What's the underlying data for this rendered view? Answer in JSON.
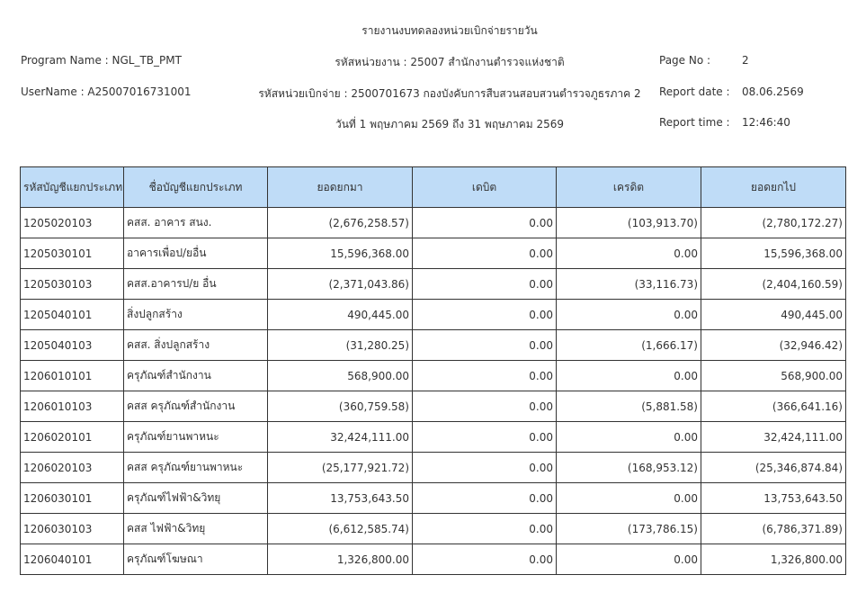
{
  "report": {
    "title": "รายงานงบทดลองหน่วยเบิกจ่ายรายวัน",
    "program_name": "Program Name : NGL_TB_PMT",
    "user_name": "UserName : A25007016731001",
    "agency": "รหัสหน่วยงาน : 25007 สำนักงานตำรวจแห่งชาติ",
    "disbursement_unit": "รหัสหน่วยเบิกจ่าย : 2500701673 กองบังคับการสืบสวนสอบสวนตำรวจภูธรภาค 2",
    "period": "วันที่ 1 พฤษภาคม 2569 ถึง 31 พฤษภาคม 2569",
    "page_no_label": "Page No :",
    "page_no_value": "2",
    "report_date_label": "Report date :",
    "report_date_value": "08.06.2569",
    "report_time_label": "Report time :",
    "report_time_value": "12:46:40"
  },
  "table": {
    "columns": [
      "รหัสบัญชีแยกประเภท",
      "ชื่อบัญชีแยกประเภท",
      "ยอดยกมา",
      "เดบิต",
      "เครดิต",
      "ยอดยกไป"
    ],
    "rows": [
      [
        "1205020103",
        "คสส. อาคาร สนง.",
        "(2,676,258.57)",
        "0.00",
        "(103,913.70)",
        "(2,780,172.27)"
      ],
      [
        "1205030101",
        "อาคารเพื่อป/ยอื่น",
        "15,596,368.00",
        "0.00",
        "0.00",
        "15,596,368.00"
      ],
      [
        "1205030103",
        "คสส.อาคารป/ย อื่น",
        "(2,371,043.86)",
        "0.00",
        "(33,116.73)",
        "(2,404,160.59)"
      ],
      [
        "1205040101",
        "สิ่งปลูกสร้าง",
        "490,445.00",
        "0.00",
        "0.00",
        "490,445.00"
      ],
      [
        "1205040103",
        "คสส. สิ่งปลูกสร้าง",
        "(31,280.25)",
        "0.00",
        "(1,666.17)",
        "(32,946.42)"
      ],
      [
        "1206010101",
        "ครุภัณฑ์สำนักงาน",
        "568,900.00",
        "0.00",
        "0.00",
        "568,900.00"
      ],
      [
        "1206010103",
        "คสส ครุภัณฑ์สำนักงาน",
        "(360,759.58)",
        "0.00",
        "(5,881.58)",
        "(366,641.16)"
      ],
      [
        "1206020101",
        "ครุภัณฑ์ยานพาหนะ",
        "32,424,111.00",
        "0.00",
        "0.00",
        "32,424,111.00"
      ],
      [
        "1206020103",
        "คสส ครุภัณฑ์ยานพาหนะ",
        "(25,177,921.72)",
        "0.00",
        "(168,953.12)",
        "(25,346,874.84)"
      ],
      [
        "1206030101",
        "ครุภัณฑ์ไฟฟ้า&วิทยุ",
        "13,753,643.50",
        "0.00",
        "0.00",
        "13,753,643.50"
      ],
      [
        "1206030103",
        "คสส ไฟฟ้า&วิทยุ",
        "(6,612,585.74)",
        "0.00",
        "(173,786.15)",
        "(6,786,371.89)"
      ],
      [
        "1206040101",
        "ครุภัณฑ์โฆษณา",
        "1,326,800.00",
        "0.00",
        "0.00",
        "1,326,800.00"
      ]
    ]
  }
}
